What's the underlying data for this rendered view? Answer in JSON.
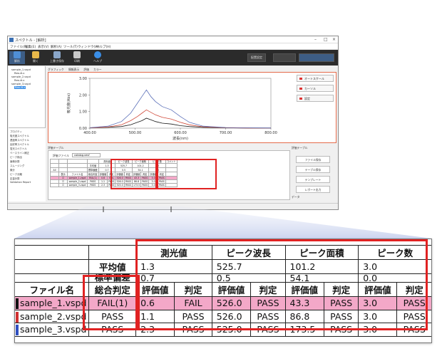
{
  "window": {
    "title": "スペクトル - [解析]",
    "menu": [
      "ファイル(F)",
      "編集(E)",
      "表示(V)",
      "解析(A)",
      "ツール(T)",
      "ウィンドウ(W)",
      "ヘルプ(H)"
    ],
    "ribbon": [
      {
        "label": "解析",
        "icon": "analysis-icon",
        "color": "#4f8fd6"
      },
      {
        "label": "開く",
        "icon": "open-folder-icon",
        "color": "#e8b84a"
      },
      {
        "label": "上書き保存",
        "icon": "save-icon",
        "color": "#8aa6c8"
      },
      {
        "label": "印刷",
        "icon": "print-icon",
        "color": "#c9c9c9"
      },
      {
        "label": "ヘルプ",
        "icon": "help-icon",
        "color": "#3a8ee6"
      }
    ],
    "ribbon_right": [
      "配置設定",
      "",
      ""
    ]
  },
  "tree": {
    "items": [
      "sample_1.vspd",
      "Result.x",
      "sample_2.vspd",
      "Result.x",
      "sample_3.vspd",
      "Result.x"
    ]
  },
  "left_lower": {
    "items": [
      "プロパティ",
      "吸光度スペクトル",
      "透過率スペクトル",
      "反射率スペクトル",
      "蛍光スペクトル",
      "ベースライン補正",
      "ピーク検出",
      "面積計算",
      "スムージング",
      "微分",
      "ピーク分離",
      "定量計算",
      "Validation Report"
    ]
  },
  "graph": {
    "tabs": [
      "グラフィック",
      "情報表示",
      "評価",
      "カラー"
    ],
    "ylabel": "吸光度(Abs)",
    "xlabel": "波長(nm)"
  },
  "side_buttons": [
    "オートスケール",
    "カーソル",
    "設定"
  ],
  "eval": {
    "header": "評価テーブル",
    "file_label": "評価ファイル",
    "file_value": "catalog.vevf",
    "right_header": "評価テーブル",
    "right_buttons": [
      "ファイル保存",
      "テーブル保存",
      "テンプレート",
      "レポート出力"
    ],
    "right_footer": "データ"
  },
  "chart_data": {
    "type": "line",
    "xlabel": "波長(nm)",
    "ylabel": "吸光度(Abs)",
    "xlim": [
      400,
      800
    ],
    "ylim": [
      0,
      3
    ],
    "xticks": [
      "400.00",
      "500.00",
      "600.00",
      "700.00",
      "800.00"
    ],
    "yticks": [
      "3.00",
      "2.00",
      "1.00",
      "0.00"
    ],
    "x": [
      400,
      440,
      470,
      490,
      505,
      515,
      525,
      535,
      545,
      560,
      580,
      600,
      620,
      650,
      700,
      750,
      800
    ],
    "series": [
      {
        "color": "#1a1a1a",
        "values": [
          0.02,
          0.05,
          0.1,
          0.2,
          0.35,
          0.45,
          0.6,
          0.5,
          0.4,
          0.3,
          0.25,
          0.15,
          0.1,
          0.05,
          0.02,
          0.01,
          0.01
        ]
      },
      {
        "color": "#d04a3a",
        "values": [
          0.02,
          0.07,
          0.2,
          0.45,
          0.7,
          0.9,
          1.1,
          0.95,
          0.8,
          0.65,
          0.55,
          0.35,
          0.2,
          0.08,
          0.03,
          0.01,
          0.01
        ]
      },
      {
        "color": "#5a6fb8",
        "values": [
          0.03,
          0.12,
          0.4,
          0.9,
          1.5,
          1.9,
          2.3,
          1.9,
          1.6,
          1.3,
          1.1,
          0.7,
          0.35,
          0.12,
          0.04,
          0.02,
          0.01
        ]
      }
    ]
  },
  "table": {
    "groups": [
      "測光値",
      "ピーク波長",
      "ピーク面積",
      "ピーク数"
    ],
    "avg_label": "平均値",
    "std_label": "標準偏差",
    "avg": [
      "1.3",
      "525.7",
      "101.2",
      "3.0"
    ],
    "std": [
      "0.7",
      "0.5",
      "54.1",
      "0.0"
    ],
    "col_filename": "ファイル名",
    "col_overall": "総合判定",
    "col_value": "評価値",
    "col_judge": "判定",
    "rows": [
      {
        "name": "sample_1.vspd",
        "color": "#111111",
        "overall": "FAIL(1)",
        "v": [
          "0.6",
          "FAIL",
          "526.0",
          "PASS",
          "43.3",
          "PASS",
          "3.0",
          "PASS"
        ]
      },
      {
        "name": "sample_2.vspd",
        "color": "#d03030",
        "overall": "PASS",
        "v": [
          "1.1",
          "PASS",
          "526.0",
          "PASS",
          "86.8",
          "PASS",
          "3.0",
          "PASS"
        ]
      },
      {
        "name": "sample_3.vspd",
        "color": "#3050c0",
        "overall": "PASS",
        "v": [
          "2.3",
          "PASS",
          "525.0",
          "PASS",
          "173.5",
          "PASS",
          "3.0",
          "PASS"
        ]
      }
    ]
  },
  "mini_table": {
    "groups": [
      "測光値",
      "ピーク波長",
      "ピーク面積",
      "ピーク数",
      "コメント"
    ],
    "labels": [
      "All",
      "表示",
      "ファイル名",
      "総合判定",
      "評価値",
      "判定"
    ]
  }
}
